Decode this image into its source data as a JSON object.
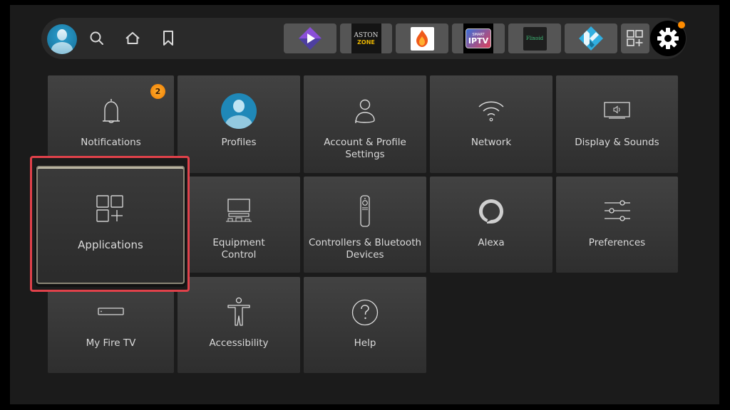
{
  "topbar": {
    "profile_avatar": "user-avatar",
    "nav": [
      {
        "name": "search",
        "icon": "search-icon"
      },
      {
        "name": "home",
        "icon": "home-icon"
      },
      {
        "name": "watchlist",
        "icon": "bookmark-icon"
      }
    ],
    "apps": [
      {
        "name": "Stremio",
        "icon": "stremio-icon"
      },
      {
        "name": "Aston",
        "icon_text": "ASTON",
        "icon_subtext": "ZONE"
      },
      {
        "name": "Fire app",
        "icon": "flame-icon"
      },
      {
        "name": "Smart IPTV",
        "icon_text": "IPTV",
        "icon_subtext": "SMART"
      },
      {
        "name": "Flixoid",
        "icon_text": "Flixoid"
      },
      {
        "name": "Kodi",
        "icon": "kodi-icon"
      }
    ],
    "all_apps_icon": "apps-grid-plus-icon",
    "settings_icon": "gear-icon",
    "settings_notification_dot_color": "#ff8c00"
  },
  "settings": {
    "focused": "Applications",
    "focus_color": "#e0414a",
    "tiles": [
      {
        "label": "Notifications",
        "icon": "bell-icon",
        "badge": "2"
      },
      {
        "label": "Profiles",
        "icon": "profile-avatar-icon"
      },
      {
        "label": "Account & Profile",
        "label2": "Settings",
        "icon": "person-icon"
      },
      {
        "label": "Network",
        "icon": "wifi-icon"
      },
      {
        "label": "Display & Sounds",
        "icon": "display-sound-icon"
      },
      {
        "label": "Applications",
        "icon": "apps-grid-plus-icon"
      },
      {
        "label": "Equipment",
        "label2": "Control",
        "icon": "equipment-icon"
      },
      {
        "label": "Controllers & Bluetooth",
        "label2": "Devices",
        "icon": "remote-icon"
      },
      {
        "label": "Alexa",
        "icon": "alexa-icon"
      },
      {
        "label": "Preferences",
        "icon": "sliders-icon"
      },
      {
        "label": "My Fire TV",
        "icon": "fire-tv-device-icon"
      },
      {
        "label": "Accessibility",
        "icon": "accessibility-icon"
      },
      {
        "label": "Help",
        "icon": "help-icon"
      }
    ]
  }
}
